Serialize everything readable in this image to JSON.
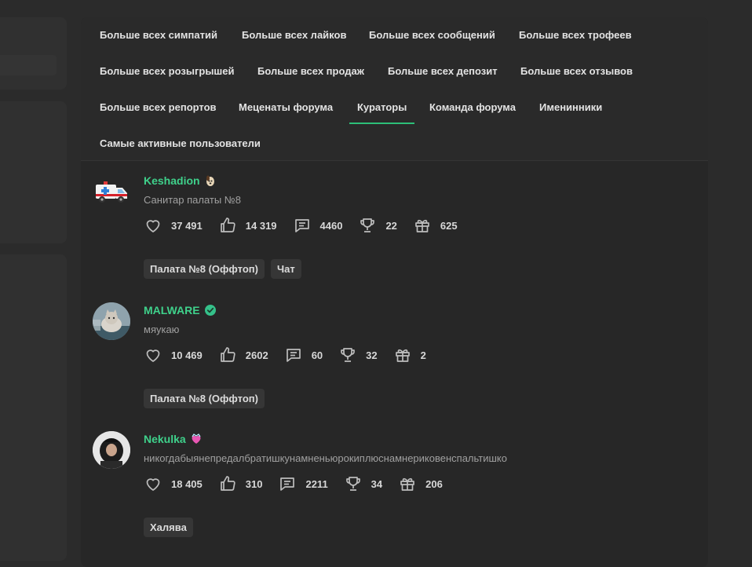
{
  "tabs": [
    {
      "label": "Больше всех симпатий"
    },
    {
      "label": "Больше всех лайков"
    },
    {
      "label": "Больше всех сообщений"
    },
    {
      "label": "Больше всех трофеев"
    },
    {
      "label": "Больше всех розыгрышей"
    },
    {
      "label": "Больше всех продаж"
    },
    {
      "label": "Больше всех депозит"
    },
    {
      "label": "Больше всех отзывов"
    },
    {
      "label": "Больше всех репортов"
    },
    {
      "label": "Меценаты форума"
    },
    {
      "label": "Кураторы",
      "active": true
    },
    {
      "label": "Команда форума"
    },
    {
      "label": "Именинники"
    },
    {
      "label": "Самые активные пользователи"
    }
  ],
  "colors": {
    "accent": "#3fd18b",
    "background": "#2b2b2b",
    "panel": "#272727",
    "tag_bg": "#363636"
  },
  "users": [
    {
      "name": "Keshadion",
      "name_badge_icon": "dog-emoji-icon",
      "status": "Санитар палаты №8",
      "avatar_icon": "ambulance-icon",
      "stats": {
        "sympathies": "37 491",
        "likes": "14 319",
        "messages": "4460",
        "trophies": "22",
        "giveaways": "625"
      },
      "tags": [
        "Палата №8 (Оффтоп)",
        "Чат"
      ]
    },
    {
      "name": "MALWARE",
      "name_badge_icon": "verified-check-icon",
      "status": "мяукаю",
      "avatar_icon": "cat-photo-avatar",
      "stats": {
        "sympathies": "10 469",
        "likes": "2602",
        "messages": "60",
        "trophies": "32",
        "giveaways": "2"
      },
      "tags": [
        "Палата №8 (Оффтоп)"
      ]
    },
    {
      "name": "Nekulka",
      "name_badge_icon": "heart-ribbon-icon",
      "status": "никогдабыянепредалбратишкунамненьюрокиплюснамнериковенспальтишко",
      "avatar_icon": "girl-photo-avatar",
      "stats": {
        "sympathies": "18 405",
        "likes": "310",
        "messages": "2211",
        "trophies": "34",
        "giveaways": "206"
      },
      "tags": [
        "Халява"
      ]
    }
  ]
}
